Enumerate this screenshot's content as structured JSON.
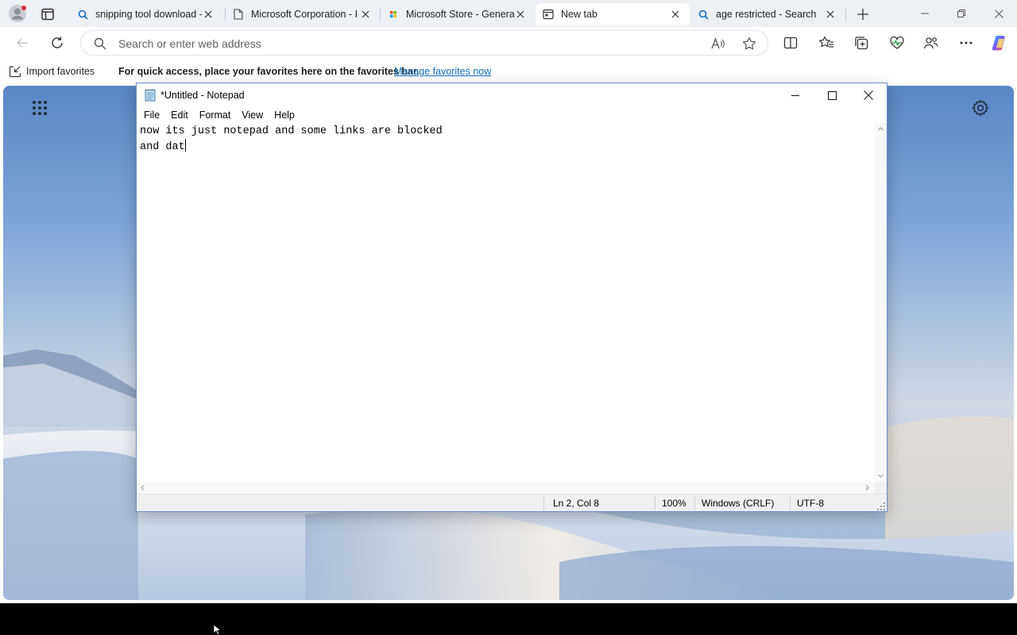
{
  "browser": {
    "tabs": [
      {
        "title": "snipping tool download -",
        "favicon": "search-icon"
      },
      {
        "title": "Microsoft Corporation - I",
        "favicon": "page-icon"
      },
      {
        "title": "Microsoft Store - General",
        "favicon": "store-icon"
      },
      {
        "title": "New tab",
        "favicon": "new-tab-icon",
        "active": true
      },
      {
        "title": "age restricted - Search",
        "favicon": "search-icon"
      }
    ],
    "address_placeholder": "Search or enter web address",
    "favorites_bar": {
      "import_label": "Import favorites",
      "hint": "For quick access, place your favorites here on the favorites bar.",
      "link": "Manage favorites now"
    },
    "colors": {
      "accent": "#0f6cbd",
      "tabstrip": "#edf0f5"
    }
  },
  "notepad": {
    "title": "*Untitled - Notepad",
    "menu": [
      "File",
      "Edit",
      "Format",
      "View",
      "Help"
    ],
    "lines": [
      "now its just notepad and some links are blocked",
      "and dat"
    ],
    "status": {
      "position": "Ln 2, Col 8",
      "zoom": "100%",
      "line_ending": "Windows (CRLF)",
      "encoding": "UTF-8"
    }
  }
}
